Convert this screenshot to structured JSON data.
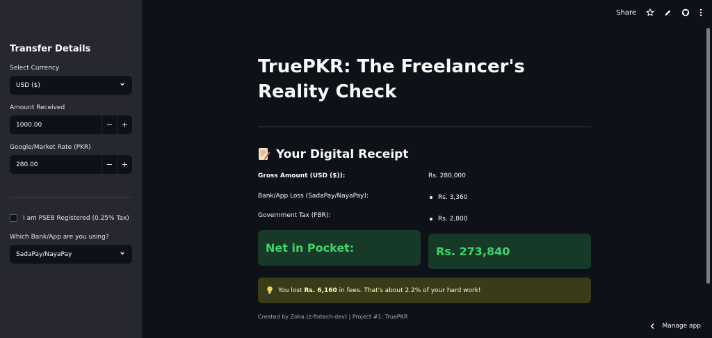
{
  "sidebar": {
    "title": "Transfer Details",
    "currency_label": "Select Currency",
    "currency_value": "USD ($)",
    "amount_label": "Amount Received",
    "amount_value": "1000.00",
    "rate_label": "Google/Market Rate (PKR)",
    "rate_value": "280.00",
    "minus": "−",
    "plus": "+",
    "pseb_label": "I am PSEB Registered (0.25% Tax)",
    "pseb_checked": false,
    "bank_label": "Which Bank/App are you using?",
    "bank_value": "SadaPay/NayaPay"
  },
  "toolbar": {
    "share": "Share",
    "icons": [
      "star-icon",
      "pencil-icon",
      "github-icon",
      "more-vertical-icon"
    ]
  },
  "main": {
    "title": "TruePKR: The Freelancer's Reality Check",
    "receipt_heading": "Your Digital Receipt",
    "receipt_icon": "memo-emoji",
    "rows": [
      {
        "label": "Gross Amount (USD ($)):",
        "value": "Rs. 280,000"
      },
      {
        "label": "Bank/App Loss (SadaPay/NayaPay):",
        "value": "Rs. 3,360"
      },
      {
        "label": "Government Tax (FBR):",
        "value": "Rs. 2,800"
      }
    ],
    "net_label": "Net in Pocket:",
    "net_value": "Rs. 273,840",
    "warning_prefix": "You lost ",
    "warning_bold": "Rs. 6,160",
    "warning_suffix": " in fees. That's about 2.2% of your hard work!",
    "warning_icon": "lightbulb-icon",
    "footer": "Created by Zoha (z-fintech-dev) | Project #1: TruePKR"
  },
  "manage_app": "Manage app",
  "colors": {
    "background": "#0e1117",
    "sidebar": "#262730",
    "success_bg": "#173928",
    "success_text": "#3dd56d",
    "warning_bg": "#3a3b18",
    "warning_text": "#ffffc2"
  }
}
